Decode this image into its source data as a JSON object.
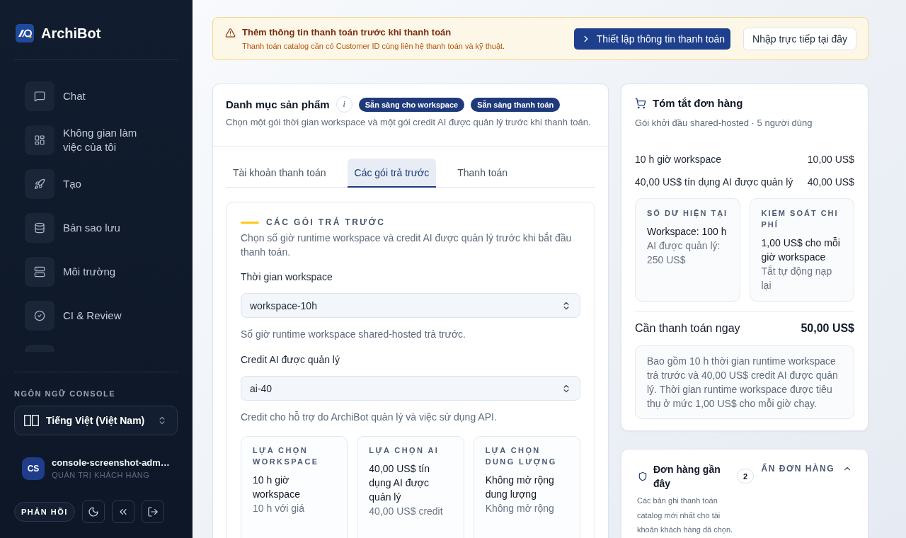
{
  "sidebar": {
    "brand": "ArchiBot",
    "nav_items": [
      {
        "label": "Chat"
      },
      {
        "label": "Không gian làm việc của tôi"
      },
      {
        "label": "Tạo"
      },
      {
        "label": "Bản sao lưu"
      },
      {
        "label": "Môi trường"
      },
      {
        "label": "CI & Review"
      }
    ],
    "language": {
      "label": "NGÔN NGỮ CONSOLE",
      "value": "Tiếng Việt (Việt Nam)"
    },
    "user": {
      "initials": "CS",
      "name": "console-screenshot-adm…",
      "role": "QUẢN TRỊ KHÁCH HÀNG"
    },
    "feedback_button": "PHẢN HỒI"
  },
  "banner": {
    "title": "Thêm thông tin thanh toán trước khi thanh toán",
    "message": "Thanh toán catalog cần có Customer ID cùng liên hệ thanh toán và kỹ thuật.",
    "primary_button": "Thiết lập thông tin thanh toán",
    "secondary_button": "Nhập trực tiếp tại đây"
  },
  "catalog": {
    "title": "Danh mục sản phẩm",
    "info_button": "i",
    "badges": [
      "Sẵn sàng cho workspace",
      "Sẵn sàng thanh toán"
    ],
    "description": "Chọn một gói thời gian workspace và một gói credit AI được quản lý trước khi thanh toán.",
    "tabs": [
      {
        "label": "Tài khoản thanh toán",
        "selected": false
      },
      {
        "label": "Các gói trả trước",
        "selected": true
      },
      {
        "label": "Thanh toán",
        "selected": false
      }
    ],
    "section": {
      "heading": "CÁC GÓI TRẢ TRƯỚC",
      "description": "Chọn số giờ runtime workspace và credit AI được quản lý trước khi bắt đầu thanh toán.",
      "fields": [
        {
          "label": "Thời gian workspace",
          "value": "workspace-10h",
          "help": "Số giờ runtime workspace shared-hosted trả trước."
        },
        {
          "label": "Credit AI được quản lý",
          "value": "ai-40",
          "help": "Credit cho hỗ trợ do ArchiBot quản lý và việc sử dụng API."
        }
      ],
      "options": [
        {
          "heading": "LỰA CHỌN WORKSPACE",
          "value": "10 h giờ workspace",
          "detail": "10 h với giá"
        },
        {
          "heading": "LỰA CHỌN AI",
          "value": "40,00 US$ tín dụng AI được quản lý",
          "detail": "40,00 US$ credit"
        },
        {
          "heading": "LỰA CHỌN DUNG LƯỢNG",
          "value": "Không mở rộng dung lượng",
          "detail": "Không mở rộng"
        }
      ]
    }
  },
  "order_summary": {
    "title": "Tóm tắt đơn hàng",
    "subtitle": "Gói khởi đầu shared-hosted · 5 người dùng",
    "lines": [
      {
        "label": "10 h giờ workspace",
        "amount": "10,00 US$"
      },
      {
        "label": "40,00 US$ tín dụng AI được quản lý",
        "amount": "40,00 US$"
      }
    ],
    "stats": [
      {
        "heading": "SỐ DƯ HIỆN TẠI",
        "value": "Workspace: 100 h",
        "detail": "AI được quản lý: 250 US$"
      },
      {
        "heading": "KIỂM SOÁT CHI PHÍ",
        "value": "1,00 US$ cho mỗi giờ workspace",
        "detail": "Tắt tự động nạp lại"
      }
    ],
    "total": {
      "label": "Cần thanh toán ngay",
      "amount": "50,00 US$"
    },
    "note": "Bao gồm 10 h thời gian runtime workspace trả trước và 40,00 US$ credit AI được quản lý. Thời gian runtime workspace được tiêu thụ ở mức 1,00 US$ cho mỗi giờ chạy."
  },
  "recent_orders": {
    "title": "Đơn hàng gần đây",
    "count": "2",
    "toggle": "ẨN ĐƠN HÀNG",
    "expanded": true,
    "description": "Các bản ghi thanh toán catalog mới nhất cho tài khoản khách hàng đã chọn."
  }
}
